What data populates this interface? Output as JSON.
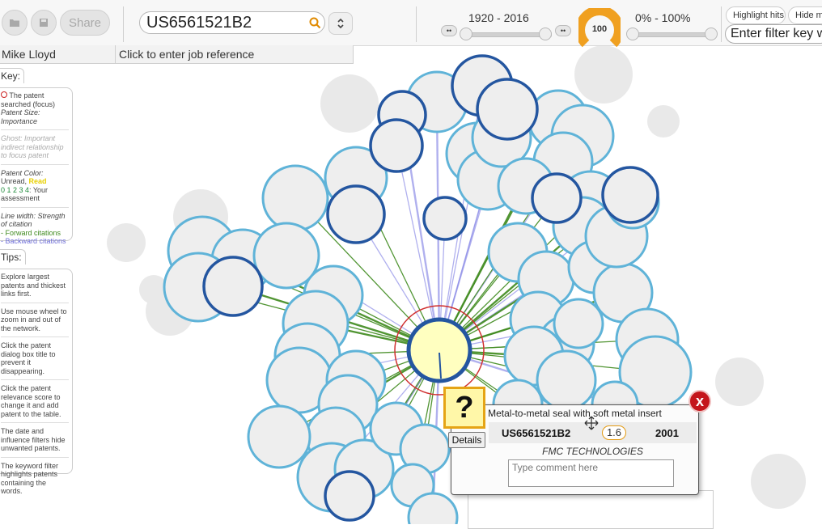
{
  "toolbar": {
    "share_label": "Share",
    "search_value": "US6561521B2",
    "date_range": "1920 - 2016",
    "relevance_range": "0% - 100%",
    "gauge_value": "100",
    "highlight_hits_label": "Highlight hits",
    "hide_label": "Hide mis",
    "filter_placeholder": "Enter filter key w",
    "mini_btn_label": "••"
  },
  "userbar": {
    "user_name": "Mike Lloyd",
    "job_reference": "Click to enter job reference"
  },
  "key_panel": {
    "tab": "Key:",
    "focus": "The patent searched (focus)",
    "size": "Patent Size: Importance",
    "ghost": "Ghost: Important indirect relationship to focus patent",
    "color_title": "Patent Color:",
    "color_unread": "Unread,",
    "color_read": "Read",
    "color_scores": "0 1 2 3 4",
    "color_suffix": ": Your assessment",
    "line_width": "Line width: Strength of citation",
    "forward": "- Forward citations",
    "backward": "- Backward citations"
  },
  "tips_panel": {
    "tab": "Tips:",
    "tips": [
      "Explore largest patents and thickest links first.",
      "Use mouse wheel to zoom in and out of the network.",
      "Click the patent dialog box title to prevent it disappearing.",
      "Click the patent relevance score to change it and add patent to the table.",
      "The date and influence filters hide unwanted patents.",
      "The keyword filter highlights patents containing the words."
    ]
  },
  "popup": {
    "title": "Metal-to-metal seal with soft metal insert",
    "patent_id": "US6561521B2",
    "score": "1.6",
    "year": "2001",
    "assignee": "FMC TECHNOLOGIES",
    "comment_placeholder": "Type comment here",
    "details_label": "Details",
    "question_mark": "?",
    "close_label": "x"
  },
  "colors": {
    "node_fill": "#eeeeee",
    "node_border_light": "#5fb3d8",
    "node_border_dark": "#2456a0",
    "focus_fill": "#ffffc0",
    "forward_citation": "#3f8a1e",
    "backward_citation": "#8f8fe8",
    "ghost_node": "#e9e9e9",
    "gauge": "#f0a020",
    "close": "#c4151b"
  }
}
